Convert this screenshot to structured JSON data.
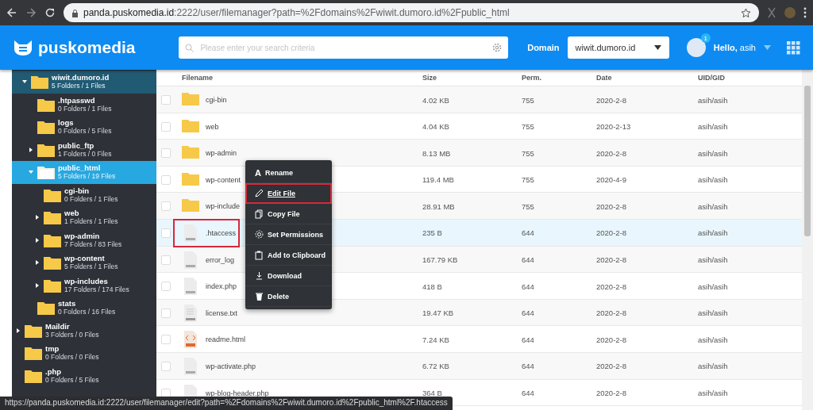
{
  "browser": {
    "url_host": "panda.puskomedia.id",
    "url_rest": ":2222/user/filemanager?path=%2Fdomains%2Fwiwit.dumoro.id%2Fpublic_html"
  },
  "header": {
    "brand": "puskomedia",
    "search": {
      "placeholder": "Please enter your search criteria"
    },
    "domain_label": "Domain",
    "domain_value": "wiwit.dumoro.id",
    "notifications": "1",
    "greeting": "Hello,",
    "user": "asih"
  },
  "tree": {
    "branch": [
      {
        "name": "wiwit.dumoro.id",
        "info": "5 Folders / 1 Files",
        "expandable": true,
        "expanded": true,
        "selected": false,
        "children": [
          {
            "name": ".htpasswd",
            "info": "0 Folders / 1 Files",
            "expandable": false,
            "expanded": false,
            "selected": false
          },
          {
            "name": "logs",
            "info": "0 Folders / 5 Files",
            "expandable": false,
            "expanded": false,
            "selected": false
          },
          {
            "name": "public_ftp",
            "info": "1 Folders / 0 Files",
            "expandable": true,
            "expanded": false,
            "selected": false
          },
          {
            "name": "public_html",
            "info": "5 Folders / 19 Files",
            "expandable": true,
            "expanded": true,
            "selected": true,
            "children": [
              {
                "name": "cgi-bin",
                "info": "0 Folders / 1 Files",
                "expandable": false,
                "expanded": false,
                "selected": false
              },
              {
                "name": "web",
                "info": "1 Folders / 1 Files",
                "expandable": true,
                "expanded": false,
                "selected": false
              },
              {
                "name": "wp-admin",
                "info": "7 Folders / 83 Files",
                "expandable": true,
                "expanded": false,
                "selected": false
              },
              {
                "name": "wp-content",
                "info": "5 Folders / 1 Files",
                "expandable": true,
                "expanded": false,
                "selected": false
              },
              {
                "name": "wp-includes",
                "info": "17 Folders / 174 Files",
                "expandable": true,
                "expanded": false,
                "selected": false
              }
            ]
          },
          {
            "name": "stats",
            "info": "0 Folders / 16 Files",
            "expandable": false,
            "expanded": false,
            "selected": false
          }
        ]
      }
    ],
    "items": [
      {
        "name": "Maildir",
        "info": "3 Folders / 0 Files",
        "expandable": true,
        "expanded": false,
        "selected": false
      },
      {
        "name": "tmp",
        "info": "0 Folders / 0 Files",
        "expandable": false,
        "expanded": false,
        "selected": false
      },
      {
        "name": ".php",
        "info": "0 Folders / 5 Files",
        "expandable": false,
        "expanded": false,
        "selected": false
      }
    ]
  },
  "table": {
    "columns": [
      "Filename",
      "Size",
      "Perm.",
      "Date",
      "UID/GID"
    ],
    "rows": [
      {
        "kind": "folder",
        "name": "cgi-bin",
        "size": "4.02 KB",
        "perm": "755",
        "date": "2020-2-8",
        "owner": "asih/asih",
        "selected": false,
        "outlined": false
      },
      {
        "kind": "folder",
        "name": "web",
        "size": "4.04 KB",
        "perm": "755",
        "date": "2020-2-13",
        "owner": "asih/asih",
        "selected": false,
        "outlined": false
      },
      {
        "kind": "folder",
        "name": "wp-admin",
        "size": "8.13 MB",
        "perm": "755",
        "date": "2020-2-8",
        "owner": "asih/asih",
        "selected": false,
        "outlined": false
      },
      {
        "kind": "folder",
        "name": "wp-content",
        "size": "119.4 MB",
        "perm": "755",
        "date": "2020-4-9",
        "owner": "asih/asih",
        "selected": false,
        "outlined": false
      },
      {
        "kind": "folder",
        "name": "wp-include",
        "size": "28.91 MB",
        "perm": "755",
        "date": "2020-2-8",
        "owner": "asih/asih",
        "selected": false,
        "outlined": false
      },
      {
        "kind": "file",
        "name": ".htaccess",
        "size": "235 B",
        "perm": "644",
        "date": "2020-2-8",
        "owner": "asih/asih",
        "selected": true,
        "outlined": true
      },
      {
        "kind": "file",
        "name": "error_log",
        "size": "167.79 KB",
        "perm": "644",
        "date": "2020-2-8",
        "owner": "asih/asih",
        "selected": false,
        "outlined": false
      },
      {
        "kind": "file",
        "name": "index.php",
        "size": "418 B",
        "perm": "644",
        "date": "2020-2-8",
        "owner": "asih/asih",
        "selected": false,
        "outlined": false
      },
      {
        "kind": "text",
        "name": "license.txt",
        "size": "19.47 KB",
        "perm": "644",
        "date": "2020-2-8",
        "owner": "asih/asih",
        "selected": false,
        "outlined": false
      },
      {
        "kind": "html",
        "name": "readme.html",
        "size": "7.24 KB",
        "perm": "644",
        "date": "2020-2-8",
        "owner": "asih/asih",
        "selected": false,
        "outlined": false
      },
      {
        "kind": "file",
        "name": "wp-activate.php",
        "size": "6.72 KB",
        "perm": "644",
        "date": "2020-2-8",
        "owner": "asih/asih",
        "selected": false,
        "outlined": false
      },
      {
        "kind": "file",
        "name": "wp-blog-header.php",
        "size": "364 B",
        "perm": "644",
        "date": "2020-2-8",
        "owner": "asih/asih",
        "selected": false,
        "outlined": false
      }
    ]
  },
  "context_menu": {
    "items": [
      {
        "kind": "rename",
        "icon": "A",
        "label": "Rename",
        "hovered": false,
        "outlined": false
      },
      {
        "kind": "edit",
        "label": "Edit File",
        "hovered": true,
        "outlined": true
      },
      {
        "kind": "copy",
        "label": "Copy File",
        "hovered": false,
        "outlined": false
      },
      {
        "kind": "permissions",
        "label": "Set Permissions",
        "hovered": false,
        "outlined": false
      },
      {
        "kind": "clipboard",
        "label": "Add to Clipboard",
        "hovered": false,
        "outlined": false
      },
      {
        "kind": "download",
        "label": "Download",
        "hovered": false,
        "outlined": false
      },
      {
        "kind": "delete",
        "label": "Delete",
        "hovered": false,
        "outlined": false
      }
    ]
  },
  "status_bar": {
    "link": "https://panda.puskomedia.id:2222/user/filemanager/edit?path=%2Fdomains%2Fwiwit.dumoro.id%2Fpublic_html%2F.htaccess"
  }
}
